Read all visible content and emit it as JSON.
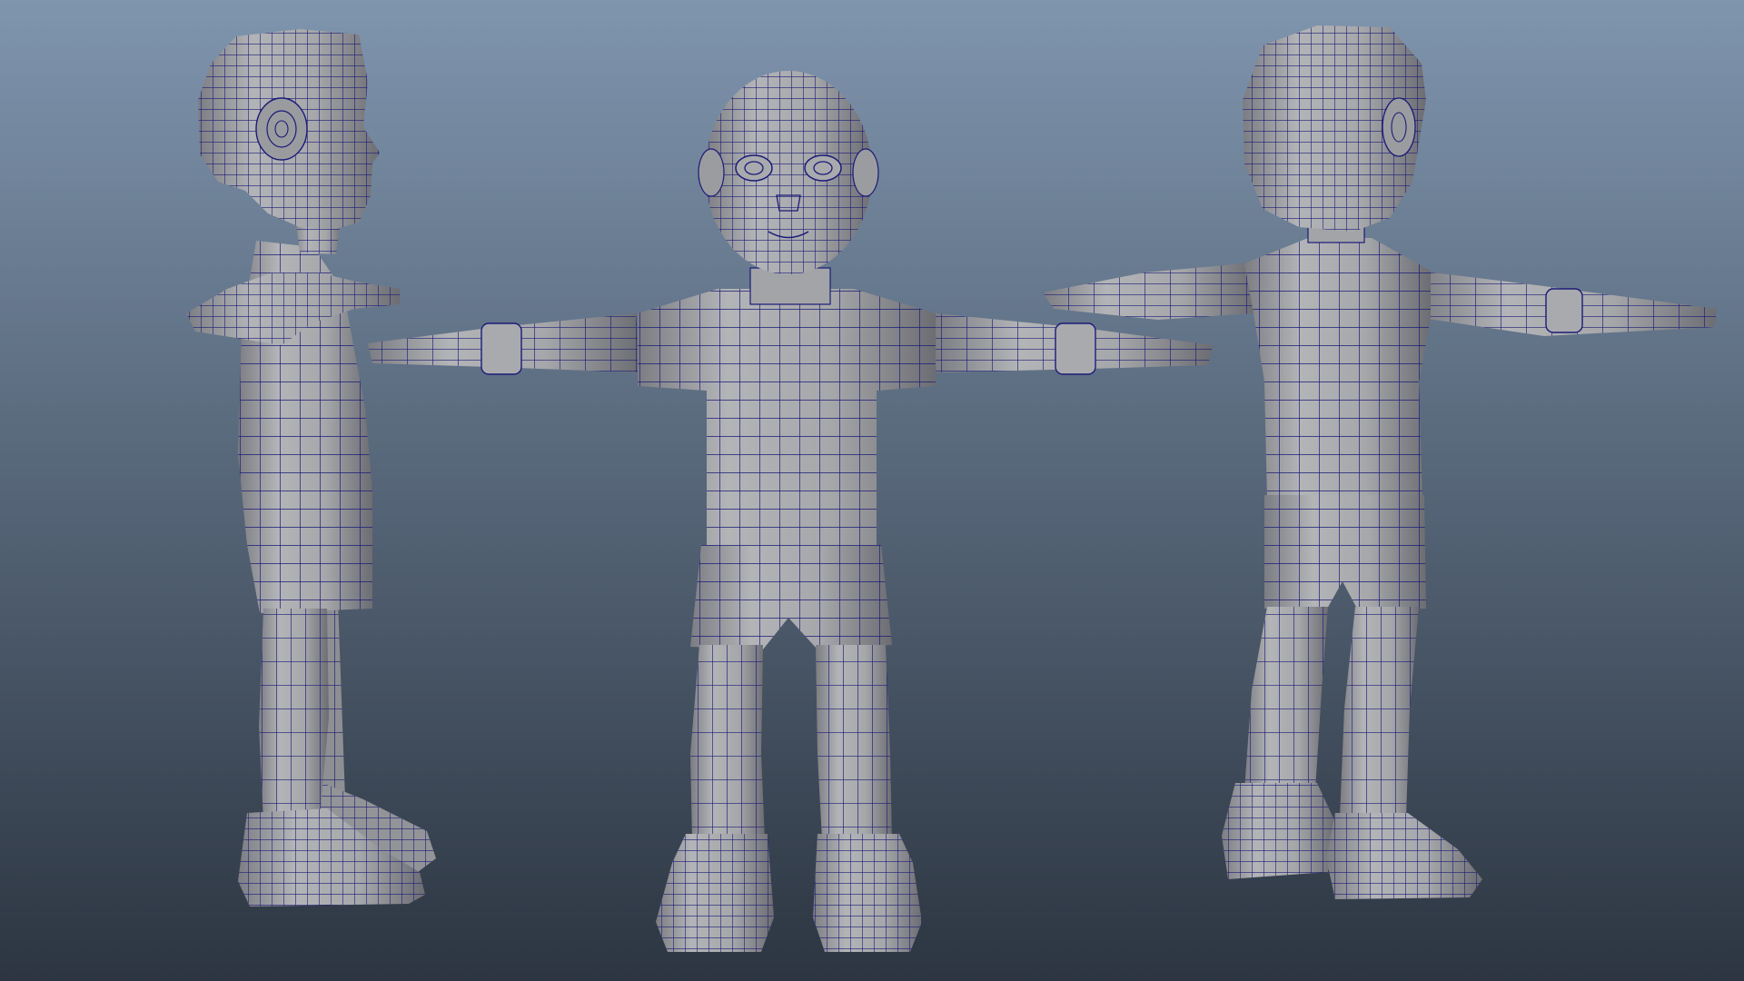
{
  "viewport": {
    "bg_top": "#7f95ae",
    "bg_bottom": "#2c3541",
    "mesh_fill": "#a7a8ab",
    "mesh_shadow": "#707177",
    "wire_color": "#1b1b78"
  },
  "models": [
    {
      "name": "side-view"
    },
    {
      "name": "front-view"
    },
    {
      "name": "back-view"
    }
  ]
}
